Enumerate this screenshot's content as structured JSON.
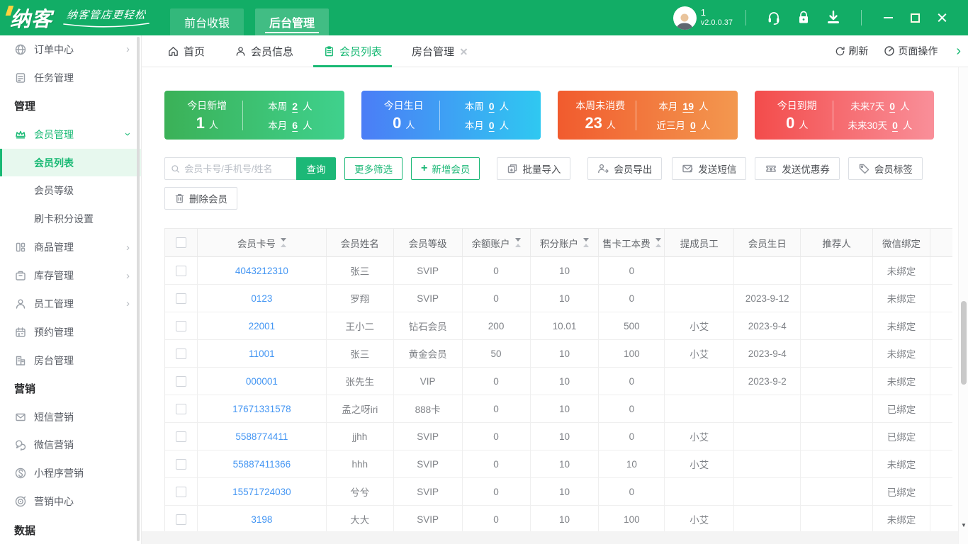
{
  "topbar": {
    "logo": "纳客",
    "slogan": "纳客管店更轻松",
    "nav": [
      {
        "label": "前台收银"
      },
      {
        "label": "后台管理",
        "active": true
      }
    ],
    "user": {
      "name": "1",
      "version": "v2.0.0.37"
    }
  },
  "sidebar": {
    "items": [
      {
        "label": "订单中心",
        "type": "item",
        "icon": "globe-icon",
        "has_children": true
      },
      {
        "label": "任务管理",
        "type": "item",
        "icon": "task-icon"
      },
      {
        "label": "管理",
        "type": "section"
      },
      {
        "label": "会员管理",
        "type": "item",
        "icon": "crown-icon",
        "expanded": true,
        "highlighted": true
      },
      {
        "label": "会员列表",
        "type": "subitem",
        "active": true
      },
      {
        "label": "会员等级",
        "type": "subitem"
      },
      {
        "label": "刷卡积分设置",
        "type": "subitem"
      },
      {
        "label": "商品管理",
        "type": "item",
        "icon": "goods-icon",
        "has_children": true
      },
      {
        "label": "库存管理",
        "type": "item",
        "icon": "inventory-icon",
        "has_children": true
      },
      {
        "label": "员工管理",
        "type": "item",
        "icon": "staff-icon",
        "has_children": true
      },
      {
        "label": "预约管理",
        "type": "item",
        "icon": "calendar-icon"
      },
      {
        "label": "房台管理",
        "type": "item",
        "icon": "room-icon"
      },
      {
        "label": "营销",
        "type": "section"
      },
      {
        "label": "短信营销",
        "type": "item",
        "icon": "mail-icon"
      },
      {
        "label": "微信营销",
        "type": "item",
        "icon": "wechat-icon"
      },
      {
        "label": "小程序营销",
        "type": "item",
        "icon": "miniapp-icon"
      },
      {
        "label": "营销中心",
        "type": "item",
        "icon": "target-icon"
      },
      {
        "label": "数据",
        "type": "section"
      }
    ]
  },
  "tabbar": {
    "tabs": [
      {
        "label": "首页",
        "icon": "home-icon"
      },
      {
        "label": "会员信息",
        "icon": "user-icon"
      },
      {
        "label": "会员列表",
        "icon": "list-icon",
        "active": true
      },
      {
        "label": "房台管理",
        "closable": true
      }
    ],
    "refresh_label": "刷新",
    "page_ops_label": "页面操作"
  },
  "stat_cards": [
    {
      "title": "今日新增",
      "value": "1",
      "unit": "人",
      "gradient": [
        "#3bb157",
        "#3fd18d"
      ],
      "rows": [
        {
          "label": "本周",
          "value": "2",
          "unit": "人"
        },
        {
          "label": "本月",
          "value": "6",
          "unit": "人"
        }
      ]
    },
    {
      "title": "今日生日",
      "value": "0",
      "unit": "人",
      "gradient": [
        "#4b7df6",
        "#2fc8f1"
      ],
      "rows": [
        {
          "label": "本周",
          "value": "0",
          "unit": "人"
        },
        {
          "label": "本月",
          "value": "0",
          "unit": "人"
        }
      ]
    },
    {
      "title": "本周未消费",
      "value": "23",
      "unit": "人",
      "gradient": [
        "#f15b2e",
        "#f3984f"
      ],
      "rows": [
        {
          "label": "本月",
          "value": "19",
          "unit": "人"
        },
        {
          "label": "近三月",
          "value": "0",
          "unit": "人"
        }
      ]
    },
    {
      "title": "今日到期",
      "value": "0",
      "unit": "人",
      "gradient": [
        "#f34c4b",
        "#f98f99"
      ],
      "rows": [
        {
          "label": "未来7天",
          "value": "0",
          "unit": "人"
        },
        {
          "label": "未来30天",
          "value": "0",
          "unit": "人"
        }
      ]
    }
  ],
  "toolbar": {
    "search_placeholder": "会员卡号/手机号/姓名",
    "search_value": "",
    "search_button": "查询",
    "more_filter": "更多筛选",
    "add_member_plus": "+",
    "add_member": "新增会员",
    "batch_import": "批量导入",
    "member_export": "会员导出",
    "send_sms": "发送短信",
    "send_coupon": "发送优惠券",
    "member_tag": "会员标签",
    "delete_member": "删除会员"
  },
  "table": {
    "columns": [
      {
        "label": "会员卡号",
        "sortable": true
      },
      {
        "label": "会员姓名"
      },
      {
        "label": "会员等级"
      },
      {
        "label": "余额账户",
        "sortable": true
      },
      {
        "label": "积分账户",
        "sortable": true
      },
      {
        "label": "售卡工本费",
        "sortable": true
      },
      {
        "label": "提成员工"
      },
      {
        "label": "会员生日"
      },
      {
        "label": "推荐人"
      },
      {
        "label": "微信绑定"
      }
    ],
    "rows": [
      {
        "card_no": "4043212310",
        "name": "张三",
        "level": "SVIP",
        "balance": "0",
        "points": "10",
        "card_fee": "0",
        "staff": "",
        "birthday": "",
        "referrer": "",
        "wechat": "未绑定"
      },
      {
        "card_no": "0123",
        "name": "罗翔",
        "level": "SVIP",
        "balance": "0",
        "points": "10",
        "card_fee": "0",
        "staff": "",
        "birthday": "2023-9-12",
        "referrer": "",
        "wechat": "未绑定"
      },
      {
        "card_no": "22001",
        "name": "王小二",
        "level": "钻石会员",
        "balance": "200",
        "points": "10.01",
        "card_fee": "500",
        "staff": "小艾",
        "birthday": "2023-9-4",
        "referrer": "",
        "wechat": "未绑定"
      },
      {
        "card_no": "11001",
        "name": "张三",
        "level": "黄金会员",
        "balance": "50",
        "points": "10",
        "card_fee": "100",
        "staff": "小艾",
        "birthday": "2023-9-4",
        "referrer": "",
        "wechat": "未绑定"
      },
      {
        "card_no": "000001",
        "name": "张先生",
        "level": "VIP",
        "balance": "0",
        "points": "10",
        "card_fee": "0",
        "staff": "",
        "birthday": "2023-9-2",
        "referrer": "",
        "wechat": "未绑定"
      },
      {
        "card_no": "17671331578",
        "name": "孟之呀iri",
        "level": "888卡",
        "balance": "0",
        "points": "10",
        "card_fee": "0",
        "staff": "",
        "birthday": "",
        "referrer": "",
        "wechat": "已绑定"
      },
      {
        "card_no": "5588774411",
        "name": "jjhh",
        "level": "SVIP",
        "balance": "0",
        "points": "10",
        "card_fee": "0",
        "staff": "小艾",
        "birthday": "",
        "referrer": "",
        "wechat": "已绑定"
      },
      {
        "card_no": "55887411366",
        "name": "hhh",
        "level": "SVIP",
        "balance": "0",
        "points": "10",
        "card_fee": "10",
        "staff": "小艾",
        "birthday": "",
        "referrer": "",
        "wechat": "未绑定"
      },
      {
        "card_no": "15571724030",
        "name": "兮兮",
        "level": "SVIP",
        "balance": "0",
        "points": "10",
        "card_fee": "0",
        "staff": "",
        "birthday": "",
        "referrer": "",
        "wechat": "已绑定"
      },
      {
        "card_no": "3198",
        "name": "大大",
        "level": "SVIP",
        "balance": "0",
        "points": "10",
        "card_fee": "100",
        "staff": "小艾",
        "birthday": "",
        "referrer": "",
        "wechat": "未绑定"
      }
    ]
  },
  "colors": {
    "topbar_green": "#12ad66",
    "accent_green": "#19b974",
    "link_blue": "#4496f3",
    "card_green": [
      "#3bb157",
      "#3fd18d"
    ],
    "card_blue": [
      "#4b7df6",
      "#2fc8f1"
    ],
    "card_orange": [
      "#f15b2e",
      "#f3984f"
    ],
    "card_red": [
      "#f34c4b",
      "#f98f99"
    ]
  }
}
